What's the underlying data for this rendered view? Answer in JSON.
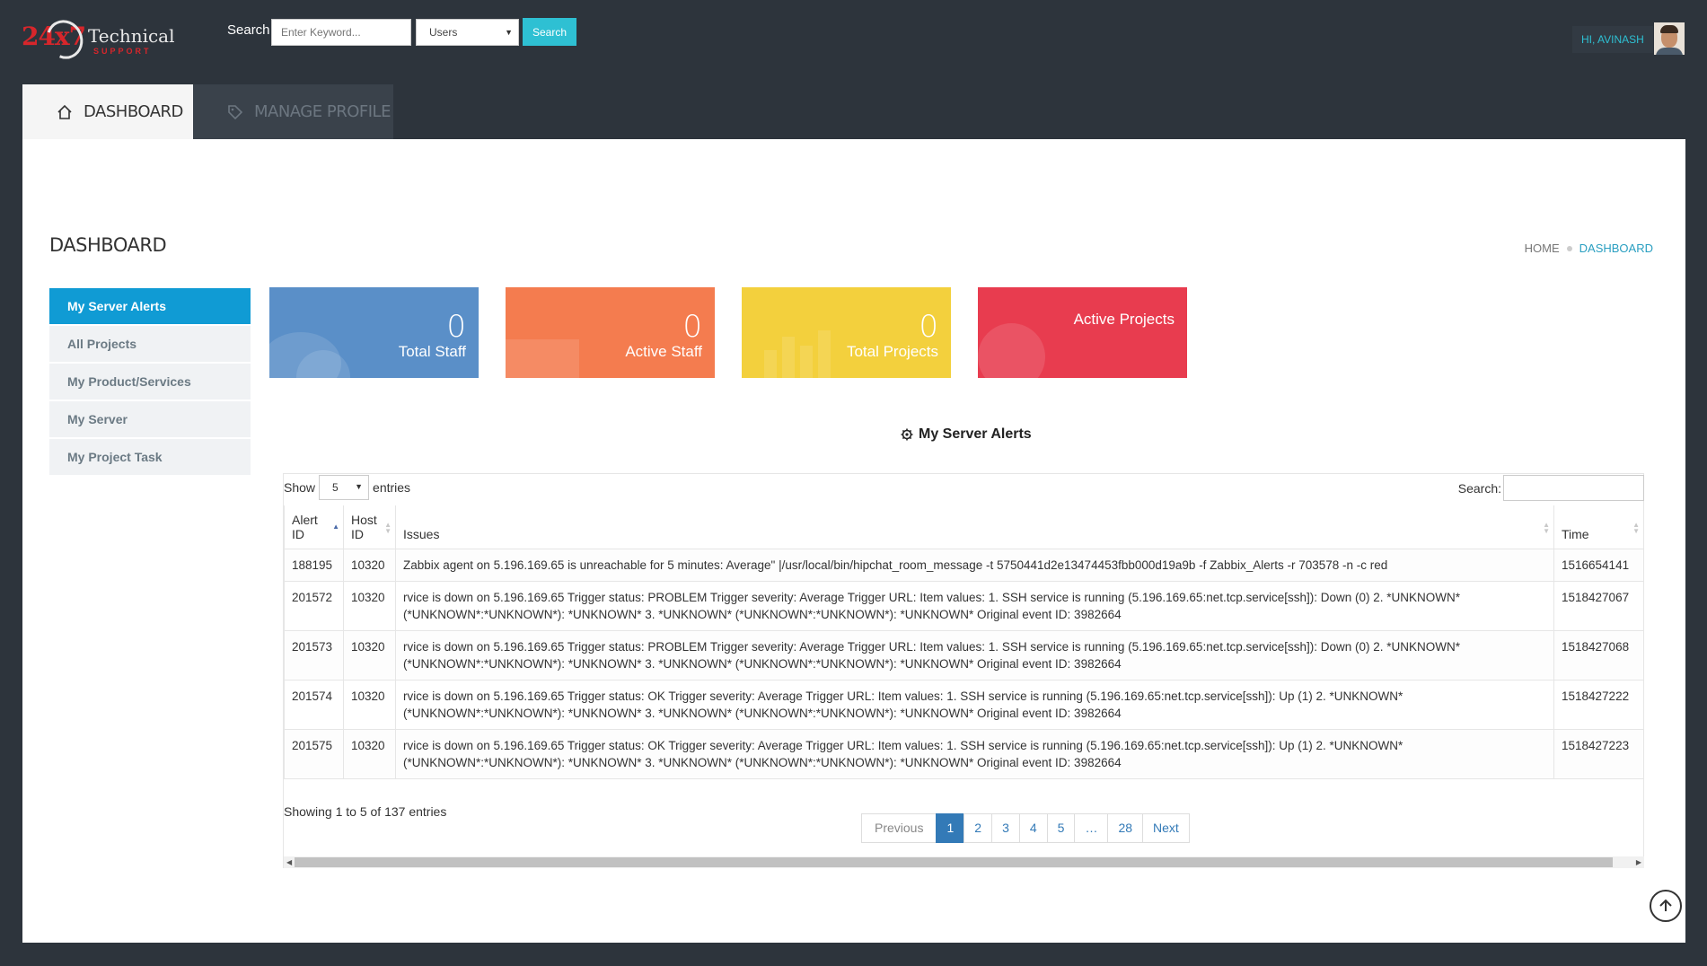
{
  "header": {
    "logo": {
      "num": "24x7",
      "tech": "Technical",
      "support": "SUPPORT"
    },
    "search_label": "Search",
    "search_placeholder": "Enter Keyword...",
    "search_scope": "Users",
    "search_button": "Search",
    "greeting": "HI, AVINASH"
  },
  "tabs": [
    {
      "label": "DASHBOARD",
      "icon": "home-icon",
      "active": true
    },
    {
      "label": "MANAGE PROFILE",
      "icon": "tag-icon",
      "active": false
    }
  ],
  "page": {
    "title": "DASHBOARD",
    "breadcrumb": {
      "home": "HOME",
      "current": "DASHBOARD"
    }
  },
  "sidebar": {
    "items": [
      {
        "label": "My Server Alerts",
        "active": true
      },
      {
        "label": "All Projects"
      },
      {
        "label": "My Product/Services"
      },
      {
        "label": "My Server"
      },
      {
        "label": "My Project Task"
      }
    ]
  },
  "cards": [
    {
      "value": "0",
      "label": "Total Staff",
      "color": "#5a8fc8"
    },
    {
      "value": "0",
      "label": "Active Staff",
      "color": "#f47c4f"
    },
    {
      "value": "0",
      "label": "Total Projects",
      "color": "#f3d03d"
    },
    {
      "value": "",
      "label": "Active Projects",
      "color": "#e83c4f"
    }
  ],
  "alerts": {
    "title": "My Server Alerts",
    "show_label": "Show",
    "entries_label": "entries",
    "page_size": "5",
    "search_label": "Search:",
    "columns": [
      "Alert ID",
      "Host ID",
      "Issues",
      "Time"
    ],
    "rows": [
      {
        "alert_id": "188195",
        "host_id": "10320",
        "issue": "Zabbix agent on 5.196.169.65 is unreachable for 5 minutes: Average\" |/usr/local/bin/hipchat_room_message -t 5750441d2e13474453fbb000d19a9b -f Zabbix_Alerts -r 703578 -n -c red",
        "time": "1516654141"
      },
      {
        "alert_id": "201572",
        "host_id": "10320",
        "issue": "rvice is down on 5.196.169.65 Trigger status: PROBLEM Trigger severity: Average Trigger URL: Item values: 1. SSH service is running (5.196.169.65:net.tcp.service[ssh]): Down (0) 2. *UNKNOWN* (*UNKNOWN*:*UNKNOWN*): *UNKNOWN* 3. *UNKNOWN* (*UNKNOWN*:*UNKNOWN*): *UNKNOWN* Original event ID: 3982664",
        "time": "1518427067"
      },
      {
        "alert_id": "201573",
        "host_id": "10320",
        "issue": "rvice is down on 5.196.169.65 Trigger status: PROBLEM Trigger severity: Average Trigger URL: Item values: 1. SSH service is running (5.196.169.65:net.tcp.service[ssh]): Down (0) 2. *UNKNOWN* (*UNKNOWN*:*UNKNOWN*): *UNKNOWN* 3. *UNKNOWN* (*UNKNOWN*:*UNKNOWN*): *UNKNOWN* Original event ID: 3982664",
        "time": "1518427068"
      },
      {
        "alert_id": "201574",
        "host_id": "10320",
        "issue": "rvice is down on 5.196.169.65 Trigger status: OK Trigger severity: Average Trigger URL: Item values: 1. SSH service is running (5.196.169.65:net.tcp.service[ssh]): Up (1) 2. *UNKNOWN* (*UNKNOWN*:*UNKNOWN*): *UNKNOWN* 3. *UNKNOWN* (*UNKNOWN*:*UNKNOWN*): *UNKNOWN* Original event ID: 3982664",
        "time": "1518427222"
      },
      {
        "alert_id": "201575",
        "host_id": "10320",
        "issue": "rvice is down on 5.196.169.65 Trigger status: OK Trigger severity: Average Trigger URL: Item values: 1. SSH service is running (5.196.169.65:net.tcp.service[ssh]): Up (1) 2. *UNKNOWN* (*UNKNOWN*:*UNKNOWN*): *UNKNOWN* 3. *UNKNOWN* (*UNKNOWN*:*UNKNOWN*): *UNKNOWN* Original event ID: 3982664",
        "time": "1518427223"
      }
    ],
    "info": "Showing 1 to 5 of 137 entries",
    "pagination": {
      "prev": "Previous",
      "pages": [
        "1",
        "2",
        "3",
        "4",
        "5",
        "…",
        "28"
      ],
      "current": "1",
      "next": "Next"
    }
  }
}
